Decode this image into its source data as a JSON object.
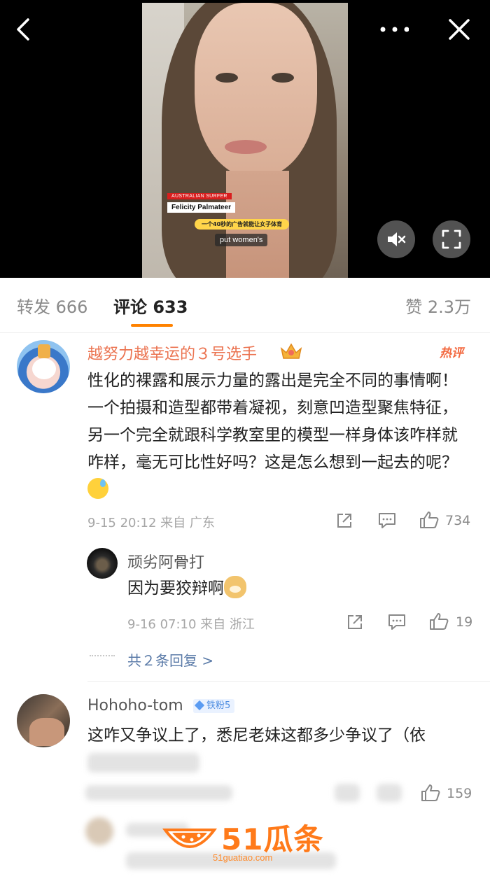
{
  "video": {
    "lower_third_tag": "AUSTRALIAN SURFER",
    "lower_third_name": "Felicity Palmateer",
    "subtitle_zh": "一个40秒的广告就能让女子体育",
    "subtitle_en": "put women's"
  },
  "tabs": {
    "repost": "转发 666",
    "comments": "评论 633",
    "likes": "赞 2.3万"
  },
  "comments": [
    {
      "username": "越努力越幸运的３号选手",
      "badge": "热评",
      "text": "性化的裸露和展示力量的露出是完全不同的事情啊！一个拍摄和造型都带着凝视，刻意凹造型聚焦特征，另一个完全就跟科学教室里的模型一样身体该咋样就咋样，毫无可比性好吗？这是怎么想到一起去的呢？",
      "meta": "9-15 20:12 来自 广东",
      "likes": "734"
    },
    {
      "username": "顽劣阿骨打",
      "text": "因为要狡辩啊",
      "meta": "9-16 07:10 来自 浙江",
      "likes": "19"
    },
    {
      "username": "Hohoho-tom",
      "fan_badge": "铁粉5",
      "text": "这咋又争议上了，悉尼老妹这都多少争议了（依",
      "likes": "159"
    }
  ],
  "replies_link": "共２条回复 >",
  "watermark": {
    "brand": "51瓜条",
    "url": "51guatiao.com"
  }
}
